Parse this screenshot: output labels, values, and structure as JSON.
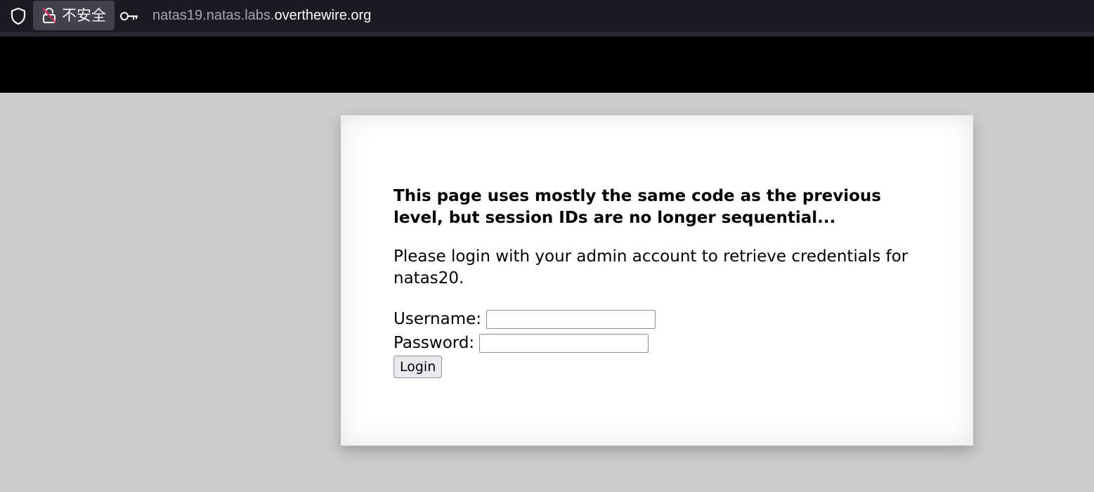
{
  "browser": {
    "security_label": "不安全",
    "url_subdomain": "natas19.natas.labs.",
    "url_domain": "overthewire.org",
    "icons": [
      "shield-icon",
      "insecure-lock-icon",
      "key-icon"
    ]
  },
  "page": {
    "heading": "This page uses mostly the same code as the previous level, but session IDs are no longer sequential...",
    "intro": "Please login with your admin account to retrieve credentials for natas20.",
    "form": {
      "username_label": "Username:",
      "username_value": "",
      "password_label": "Password:",
      "password_value": "",
      "login_label": "Login"
    }
  },
  "colors": {
    "toolbar_bg": "#1c1b22",
    "header_band": "#000000",
    "page_bg": "#cccccc",
    "content_bg": "#ffffff"
  }
}
